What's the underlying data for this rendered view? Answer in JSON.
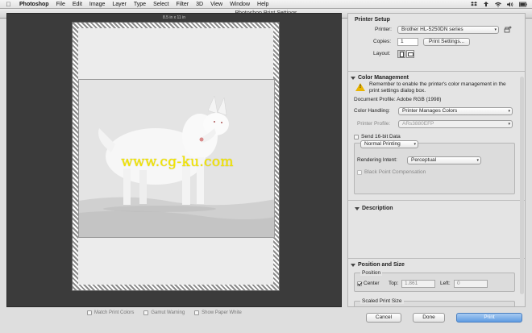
{
  "menubar": {
    "app_name": "Photoshop",
    "items": [
      "File",
      "Edit",
      "Image",
      "Layer",
      "Type",
      "Select",
      "Filter",
      "3D",
      "View",
      "Window",
      "Help"
    ],
    "status_icons": [
      "dropbox-icon",
      "upload-icon",
      "wifi-icon",
      "volume-icon",
      "battery-icon"
    ]
  },
  "window": {
    "title": "Photoshop Print Settings"
  },
  "preview": {
    "paper_size": "8.5 in x 11 in",
    "watermark": "www.cg-ku.com",
    "options": [
      {
        "label": "Match Print Colors",
        "checked": false
      },
      {
        "label": "Gamut Warning",
        "checked": false
      },
      {
        "label": "Show Paper White",
        "checked": false
      }
    ]
  },
  "printer_setup": {
    "title": "Printer Setup",
    "printer_label": "Printer:",
    "printer_value": "Brother HL-5250DN series",
    "copies_label": "Copies:",
    "copies_value": "1",
    "print_settings_button": "Print Settings...",
    "layout_label": "Layout:"
  },
  "color_management": {
    "title": "Color Management",
    "warning": "Remember to enable the printer's color management in the print settings dialog box.",
    "document_profile": "Document Profile: Adobe RGB (1998)",
    "color_handling_label": "Color Handling:",
    "color_handling_value": "Printer Manages Colors",
    "printer_profile_label": "Printer Profile:",
    "printer_profile_value": "ARs3880EFP",
    "send16_label": "Send 16-bit Data",
    "normal_printing": "Normal Printing",
    "rendering_intent_label": "Rendering Intent:",
    "rendering_intent_value": "Perceptual",
    "black_point_label": "Black Point Compensation"
  },
  "description": {
    "title": "Description"
  },
  "position_size": {
    "title": "Position and Size",
    "position_label": "Position",
    "center_label": "Center",
    "top_label": "Top:",
    "top_value": "1.861",
    "left_label": "Left:",
    "left_value": "0",
    "scaled_label": "Scaled Print Size"
  },
  "footer": {
    "cancel": "Cancel",
    "done": "Done",
    "print": "Print"
  },
  "colors": {
    "watermark": "#f3e600",
    "warning": "#e9b400",
    "primary_button": "#5f9ce2"
  }
}
